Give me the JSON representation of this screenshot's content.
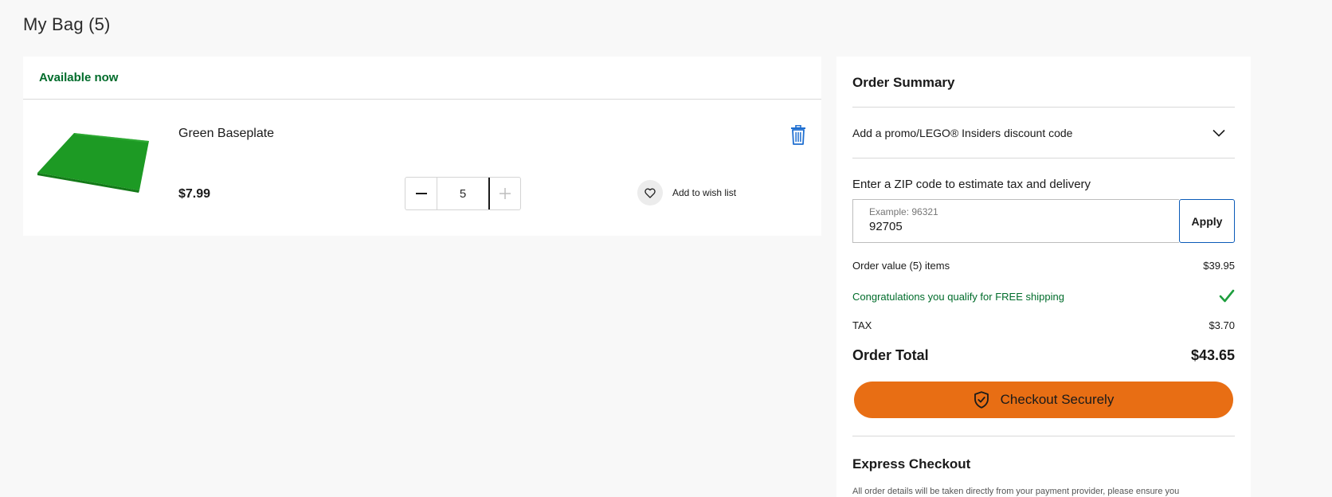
{
  "page": {
    "title": "My Bag (5)"
  },
  "bag": {
    "section_label": "Available now",
    "item": {
      "name": "Green Baseplate",
      "price": "$7.99",
      "quantity": "5",
      "wishlist_label": "Add to wish list"
    }
  },
  "summary": {
    "title": "Order Summary",
    "promo_label": "Add a promo/LEGO® Insiders discount code",
    "zip_title": "Enter a ZIP code to estimate tax and delivery",
    "zip_placeholder": "Example: 96321",
    "zip_value": "92705",
    "apply_label": "Apply",
    "order_value_label": "Order value (5) items",
    "order_value": "$39.95",
    "free_shipping_label": "Congratulations you qualify for FREE shipping",
    "tax_label": "TAX",
    "tax_value": "$3.70",
    "total_label": "Order Total",
    "total_value": "$43.65",
    "checkout_label": "Checkout Securely",
    "express_title": "Express Checkout",
    "express_note": "All order details will be taken directly from your payment provider, please ensure you"
  },
  "colors": {
    "accent_green": "#006c2b",
    "checkout_orange": "#e86e14",
    "link_blue": "#0a5ab8"
  },
  "icons": [
    "minus-icon",
    "plus-icon",
    "heart-icon",
    "trash-icon",
    "chevron-down-icon",
    "checkmark-icon",
    "shield-check-icon"
  ]
}
